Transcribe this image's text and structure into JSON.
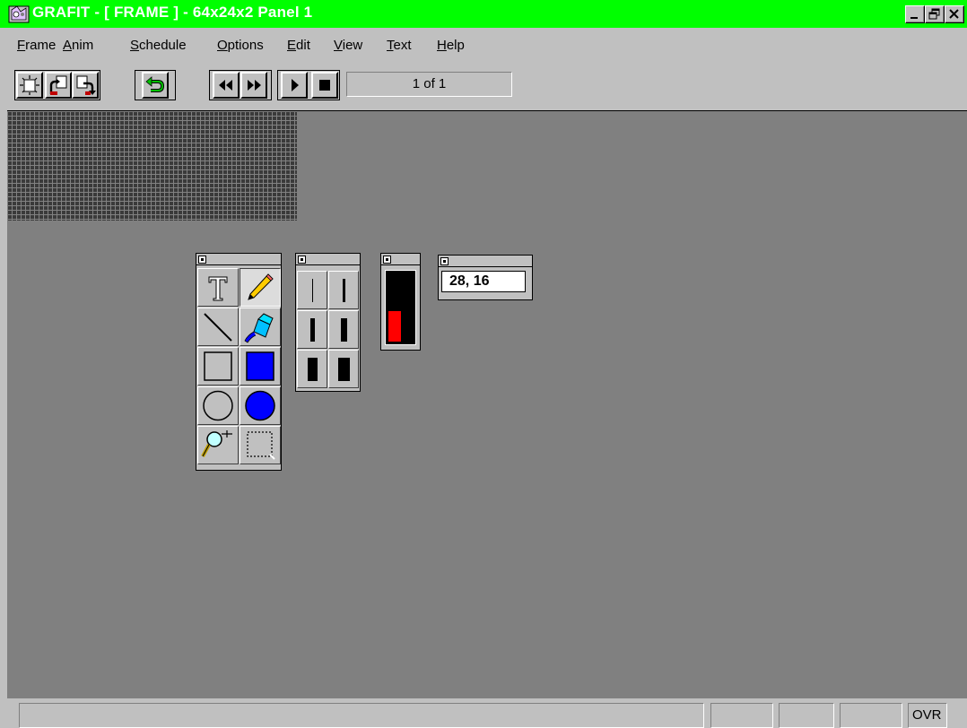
{
  "window": {
    "title": "GRAFIT - [ FRAME ] - 64x24x2 Panel 1",
    "title_bar_color": "#00ff00",
    "controls": [
      "minimize-icon",
      "restore-icon",
      "close-icon"
    ]
  },
  "menu": {
    "items": [
      {
        "label": "Frame",
        "accel": "F"
      },
      {
        "label": "Anim",
        "accel": "A"
      },
      {
        "label": "Schedule",
        "accel": "S"
      },
      {
        "label": "Options",
        "accel": "O"
      },
      {
        "label": "Edit",
        "accel": "E"
      },
      {
        "label": "View",
        "accel": "V"
      },
      {
        "label": "Text",
        "accel": "T"
      },
      {
        "label": "Help",
        "accel": "H"
      }
    ]
  },
  "toolbar": {
    "buttons": [
      "new-frame-icon",
      "copy-frame-icon",
      "paste-frame-icon",
      "undo-icon",
      "rewind-icon",
      "fast-forward-icon",
      "play-icon",
      "stop-icon"
    ],
    "frame_counter": "1 of 1"
  },
  "tools_palette": {
    "tools": [
      {
        "name": "text-tool-icon",
        "pressed": false
      },
      {
        "name": "pencil-tool-icon",
        "pressed": true
      },
      {
        "name": "line-tool-icon",
        "pressed": false
      },
      {
        "name": "fill-tool-icon",
        "pressed": false
      },
      {
        "name": "rectangle-outline-tool-icon",
        "pressed": false
      },
      {
        "name": "rectangle-filled-tool-icon",
        "pressed": false
      },
      {
        "name": "circle-outline-tool-icon",
        "pressed": false
      },
      {
        "name": "circle-filled-tool-icon",
        "pressed": false
      },
      {
        "name": "zoom-tool-icon",
        "pressed": false
      },
      {
        "name": "select-tool-icon",
        "pressed": false
      }
    ],
    "fill_color": "#0000ff"
  },
  "line_width_palette": {
    "widths": [
      "thin",
      "thin-medium",
      "medium",
      "medium-thick",
      "thick",
      "thickest"
    ]
  },
  "color_palette": {
    "selected_color": "#ff0000",
    "selected_level": 0.45
  },
  "coordinates": {
    "value": "28, 16"
  },
  "status_bar": {
    "cells": [
      "",
      "",
      "",
      "",
      "OVR"
    ]
  },
  "led_panel": {
    "off_color": "#3a3a3a",
    "grid_color": "#828282"
  }
}
